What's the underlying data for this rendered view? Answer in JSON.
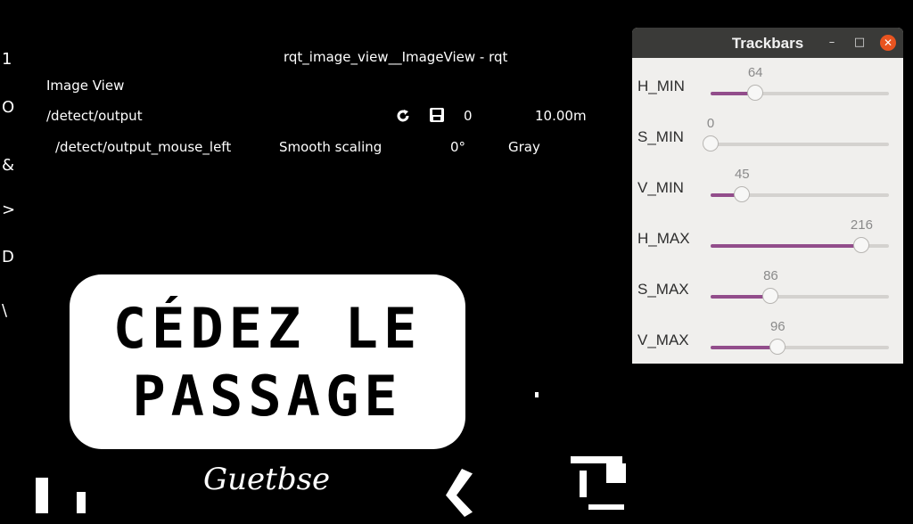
{
  "rqt": {
    "window_title": "rqt_image_view__ImageView - rqt",
    "plugin_title": "Image View",
    "topic": "/detect/output",
    "zoom": "10.00m",
    "mouse_topic": "/detect/output_mouse_left",
    "smooth_scaling_label": "Smooth scaling",
    "rotation": "0°",
    "color_scheme": "Gray",
    "refresh_icon": "refresh-icon",
    "save_icon": "save-icon",
    "side_glyphs": [
      "1",
      "O",
      "&",
      ">",
      "D",
      "\\"
    ]
  },
  "sign": {
    "line1": "CÉDEZ LE",
    "line2": "PASSAGE",
    "signature": "Guetbse"
  },
  "trackbars": {
    "title": "Trackbars",
    "min_icon": "minimize-icon",
    "max_icon": "maximize-icon",
    "close_icon": "close-icon",
    "max_value": 255,
    "colors": {
      "fill": "#924d8b",
      "titlebar": "#3a3a38",
      "close": "#e95420"
    },
    "items": [
      {
        "label": "H_MIN",
        "value": 64
      },
      {
        "label": "S_MIN",
        "value": 0
      },
      {
        "label": "V_MIN",
        "value": 45
      },
      {
        "label": "H_MAX",
        "value": 216
      },
      {
        "label": "S_MAX",
        "value": 86
      },
      {
        "label": "V_MAX",
        "value": 96
      }
    ]
  }
}
